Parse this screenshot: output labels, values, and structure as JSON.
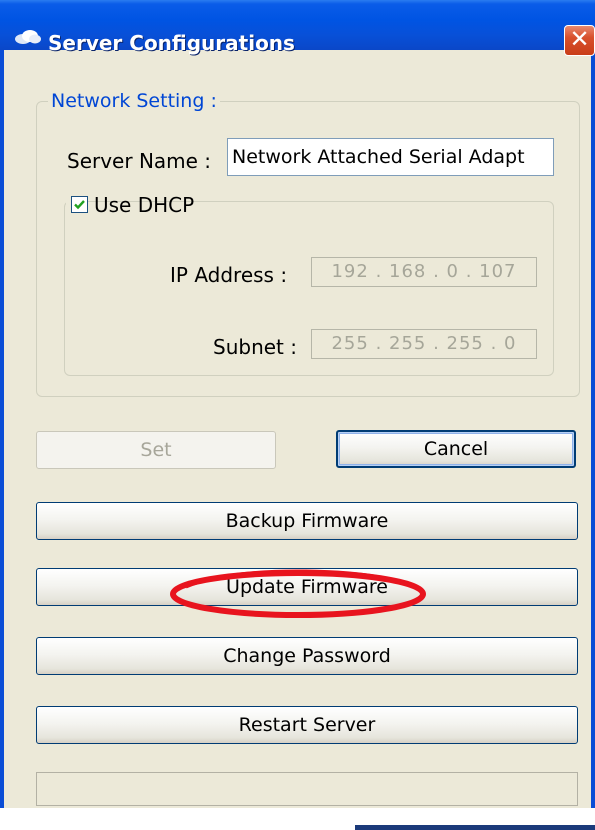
{
  "window": {
    "title": "Server Configurations",
    "close_symbol": "✕",
    "title_icon": "cloud-icon",
    "close_icon": "close-icon"
  },
  "network_setting": {
    "legend": "Network Setting :",
    "server_name_label": "Server Name :",
    "server_name_value": "Network Attached Serial Adapt",
    "use_dhcp_label": "Use DHCP",
    "use_dhcp_checked": true,
    "ip_address_label": "IP Address :",
    "ip_address_value": "192 . 168 .   0  . 107",
    "subnet_label": "Subnet :",
    "subnet_value": "255 . 255 . 255 .   0"
  },
  "buttons": {
    "set": "Set",
    "cancel": "Cancel",
    "backup_firmware": "Backup Firmware",
    "update_firmware": "Update Firmware",
    "change_password": "Change Password",
    "restart_server": "Restart Server"
  },
  "colors": {
    "title_bar": "#0054e3",
    "window_face": "#ece9d8",
    "legend_text": "#0046d5",
    "highlight_ellipse": "#e8141e",
    "checkmark": "#21a121"
  }
}
